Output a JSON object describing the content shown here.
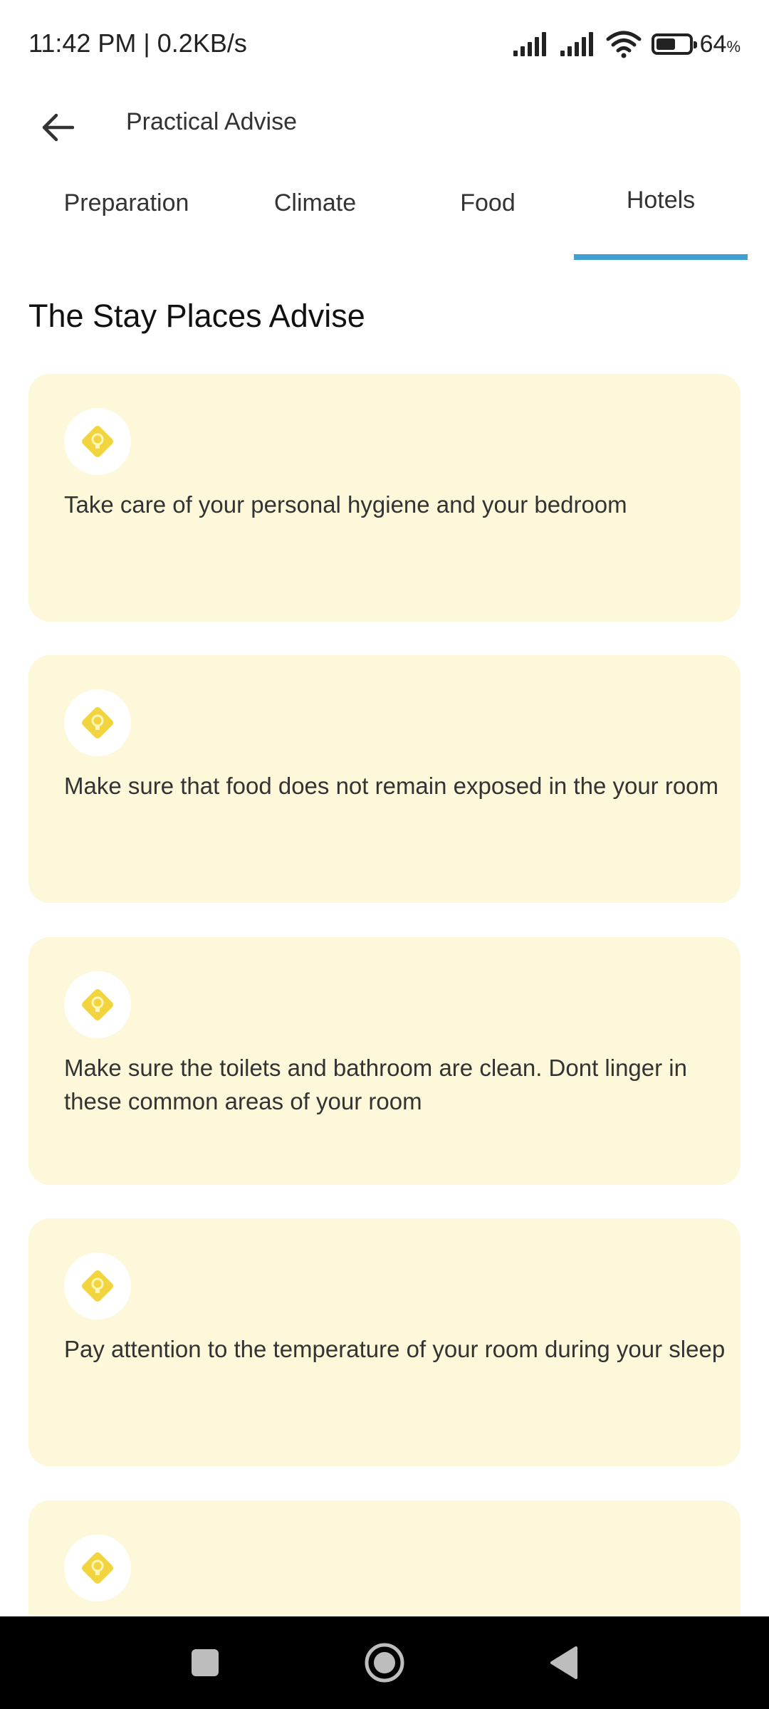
{
  "status_bar": {
    "time_speed": "11:42 PM | 0.2KB/s",
    "battery_level": 64,
    "battery_value": "64",
    "battery_unit": "%",
    "icons": [
      "signal-icon",
      "signal-icon",
      "wifi-icon",
      "battery-icon"
    ]
  },
  "app_bar": {
    "title": "Practical Advise",
    "back_icon": "arrow-left-icon"
  },
  "tabs": [
    {
      "label": "Preparation",
      "active": false
    },
    {
      "label": "Climate",
      "active": false
    },
    {
      "label": "Food",
      "active": false
    },
    {
      "label": "Hotels",
      "active": true
    }
  ],
  "section": {
    "heading": "The Stay Places Advise"
  },
  "cards": [
    {
      "icon": "lightbulb-icon",
      "text": "Take care of your personal hygiene and your bedroom"
    },
    {
      "icon": "lightbulb-icon",
      "text": "Make sure that food does not remain exposed in the your room"
    },
    {
      "icon": "lightbulb-icon",
      "text": "Make sure the toilets and bathroom are clean. Dont linger in these common areas of your room"
    },
    {
      "icon": "lightbulb-icon",
      "text": "Pay attention to the temperature of your room during your sleep"
    },
    {
      "icon": "lightbulb-icon",
      "text": ""
    }
  ],
  "nav_bar": {
    "buttons": [
      "recents-icon",
      "home-icon",
      "back-triangle-icon"
    ]
  },
  "colors": {
    "accent": "#3e9fd0",
    "card_background": "#fdf8d9",
    "icon_yellow": "#f2d43f"
  }
}
